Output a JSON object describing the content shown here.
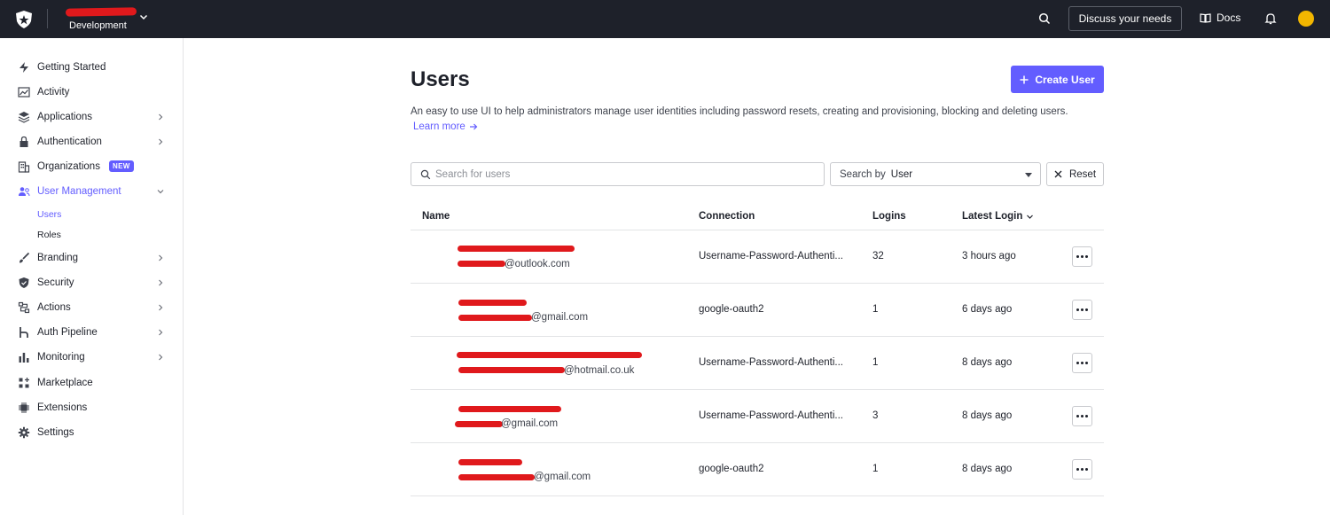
{
  "topbar": {
    "tenant_env": "Development",
    "discuss_label": "Discuss your needs",
    "docs_label": "Docs",
    "colors": {
      "bg": "#1e212a",
      "avatar": "#f2b600"
    }
  },
  "sidebar": {
    "items": [
      {
        "label": "Getting Started",
        "icon": "bolt-icon"
      },
      {
        "label": "Activity",
        "icon": "activity-chart-icon"
      },
      {
        "label": "Applications",
        "icon": "layers-icon"
      },
      {
        "label": "Authentication",
        "icon": "lock-icon"
      },
      {
        "label": "Organizations",
        "icon": "building-icon",
        "badge": "NEW"
      },
      {
        "label": "User Management",
        "icon": "users-icon"
      },
      {
        "label": "Branding",
        "icon": "brush-icon"
      },
      {
        "label": "Security",
        "icon": "shield-icon"
      },
      {
        "label": "Actions",
        "icon": "flow-icon"
      },
      {
        "label": "Auth Pipeline",
        "icon": "pipeline-icon"
      },
      {
        "label": "Monitoring",
        "icon": "bar-chart-icon"
      },
      {
        "label": "Marketplace",
        "icon": "grid-plus-icon"
      },
      {
        "label": "Extensions",
        "icon": "chip-icon"
      },
      {
        "label": "Settings",
        "icon": "gear-icon"
      }
    ],
    "sub_items": [
      "Users",
      "Roles"
    ],
    "accent": "#635dff"
  },
  "main": {
    "title": "Users",
    "create_label": "Create User",
    "description": "An easy to use UI to help administrators manage user identities including password resets, creating and provisioning, blocking and deleting users.",
    "learn_more": "Learn more",
    "search_placeholder": "Search for users",
    "searchby_prefix": "Search by",
    "searchby_value": "User",
    "reset_label": "Reset"
  },
  "table": {
    "columns": [
      "Name",
      "Connection",
      "Logins",
      "Latest Login"
    ],
    "rows": [
      {
        "email_domain": "@outlook.com",
        "connection": "Username-Password-Authenti...",
        "logins": "32",
        "latest": "3 hours ago"
      },
      {
        "email_domain": "@gmail.com",
        "connection": "google-oauth2",
        "logins": "1",
        "latest": "6 days ago"
      },
      {
        "email_domain": "@hotmail.co.uk",
        "connection": "Username-Password-Authenti...",
        "logins": "1",
        "latest": "8 days ago"
      },
      {
        "email_domain": "@gmail.com",
        "connection": "Username-Password-Authenti...",
        "logins": "3",
        "latest": "8 days ago"
      },
      {
        "email_domain": "@gmail.com",
        "connection": "google-oauth2",
        "logins": "1",
        "latest": "8 days ago"
      }
    ]
  }
}
